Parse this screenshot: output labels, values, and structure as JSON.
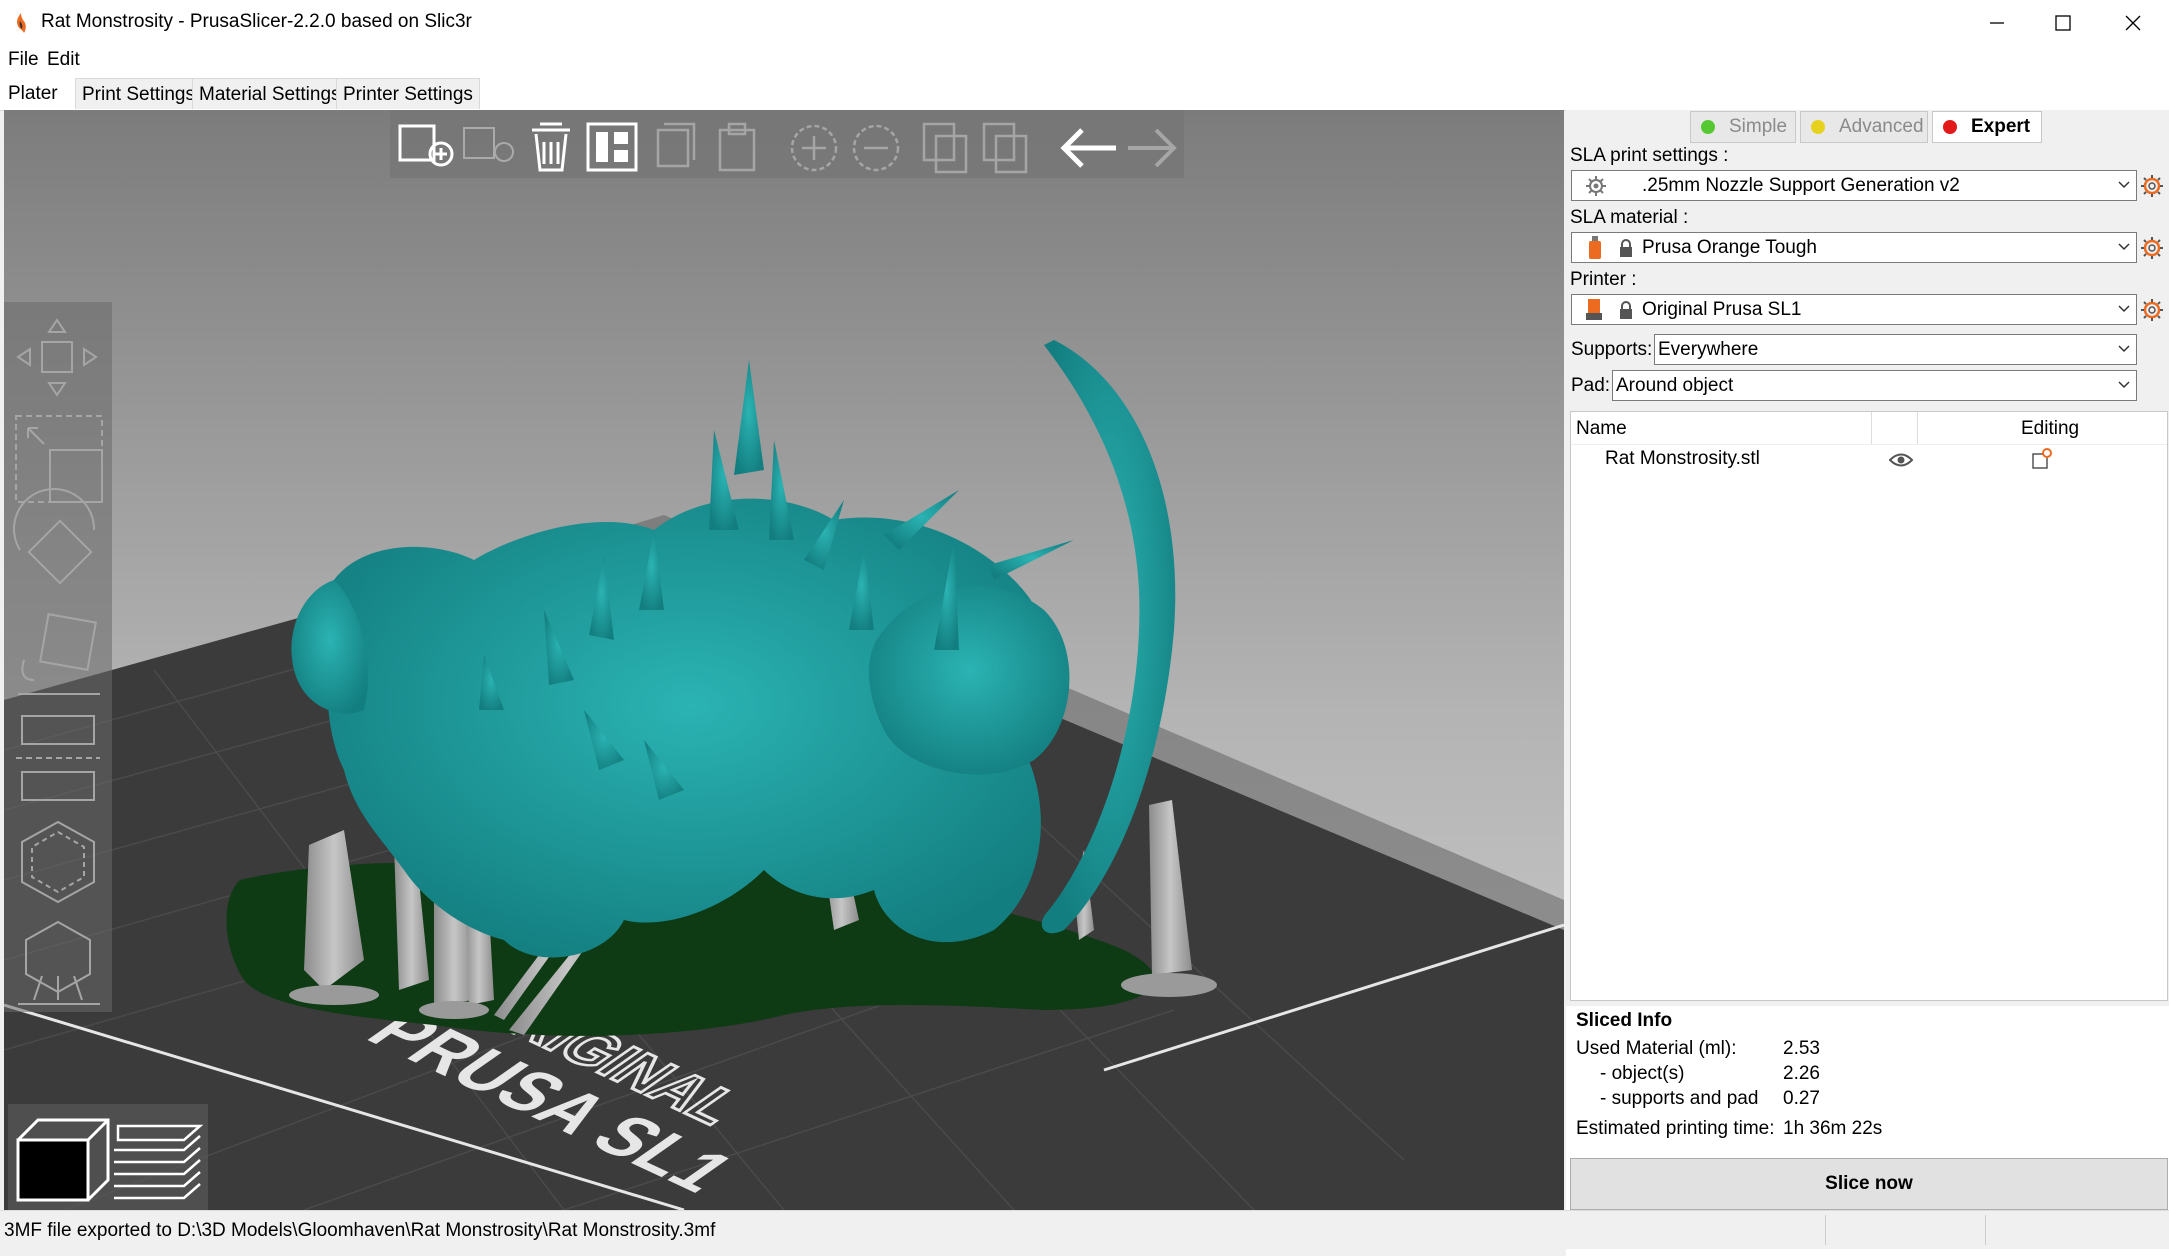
{
  "window": {
    "title": "Rat Monstrosity - PrusaSlicer-2.2.0 based on Slic3r"
  },
  "menu": [
    "File",
    "Edit"
  ],
  "tabs": [
    "Plater",
    "Print Settings",
    "Material Settings",
    "Printer Settings"
  ],
  "toolbar": {
    "icons": [
      "add-icon",
      "delete-icon",
      "delete-all-icon",
      "arrange-icon",
      "copy-icon",
      "paste-icon",
      "increase-instances-icon",
      "decrease-instances-icon",
      "split-to-objects-icon",
      "split-to-parts-icon",
      "undo-icon",
      "redo-icon"
    ]
  },
  "gizmos": [
    "move-icon",
    "scale-icon",
    "rotate-icon",
    "place-on-face-icon",
    "cut-icon",
    "hollow-icon",
    "sla-support-points-icon"
  ],
  "bed_label": [
    "ORIGINAL",
    "PRUSA SL1"
  ],
  "view_toggles": [
    "3d-view-icon",
    "preview-layers-icon"
  ],
  "mode": {
    "simple": "Simple",
    "advanced": "Advanced",
    "expert": "Expert",
    "colors": {
      "simple": "#55c832",
      "advanced": "#e6d21e",
      "expert": "#e11919"
    }
  },
  "sla_print": {
    "label": "SLA print settings :",
    "value": ".25mm Nozzle Support Generation v2"
  },
  "sla_material": {
    "label": "SLA material :",
    "value": "Prusa Orange Tough"
  },
  "printer": {
    "label": "Printer :",
    "value": "Original Prusa SL1"
  },
  "supports": {
    "label": "Supports:",
    "value": "Everywhere"
  },
  "pad": {
    "label": "Pad:",
    "value": "Around object"
  },
  "object_list": {
    "col_name": "Name",
    "col_editing": "Editing",
    "rows": [
      {
        "name": "Rat Monstrosity.stl"
      }
    ]
  },
  "sliced_info": {
    "title": "Sliced Info",
    "rows": [
      {
        "label": "Used Material (ml):",
        "value": "2.53"
      },
      {
        "label": "- object(s)",
        "value": "2.26"
      },
      {
        "label": "- supports and pad",
        "value": "0.27"
      },
      {
        "label": "Estimated printing time:",
        "value": "1h 36m 22s"
      }
    ]
  },
  "slice_button": "Slice now",
  "status": "3MF file exported to D:\\3D Models\\Gloomhaven\\Rat Monstrosity\\Rat Monstrosity.3mf",
  "colors": {
    "model": "#1a9a9a",
    "support": "#a8a8a8",
    "pad": "#0e3a14",
    "bed": "#3a3a3a",
    "accent": "#ed6b21"
  }
}
